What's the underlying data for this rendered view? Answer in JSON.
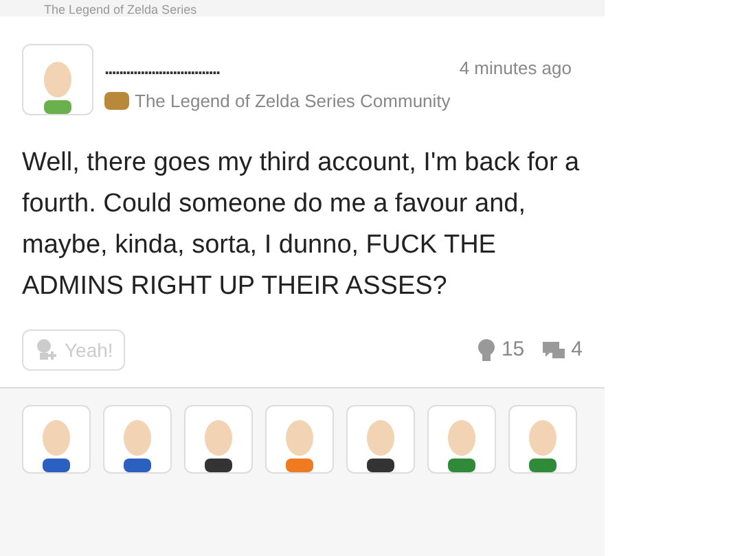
{
  "header": {
    "title": "The Legend of Zelda Series"
  },
  "post": {
    "username": "................................",
    "time": "4 minutes ago",
    "community": "The Legend of Zelda Series Community",
    "body": "Well, there goes my third account, I'm back for a fourth. Could someone do me a favour and, maybe, kinda, sorta, I dunno, FUCK THE ADMINS RIGHT UP THEIR ASSES?",
    "yeah_button": {
      "label": "Yeah!",
      "selected": false
    },
    "yeah_count": "15",
    "reply_count": "4"
  },
  "yeahs": [
    {
      "color": "#2b5fc0"
    },
    {
      "color": "#2b5fc0"
    },
    {
      "color": "#333333"
    },
    {
      "color": "#f07a20"
    },
    {
      "color": "#333333"
    },
    {
      "color": "#2f8a3a"
    },
    {
      "color": "#2f8a3a"
    }
  ]
}
